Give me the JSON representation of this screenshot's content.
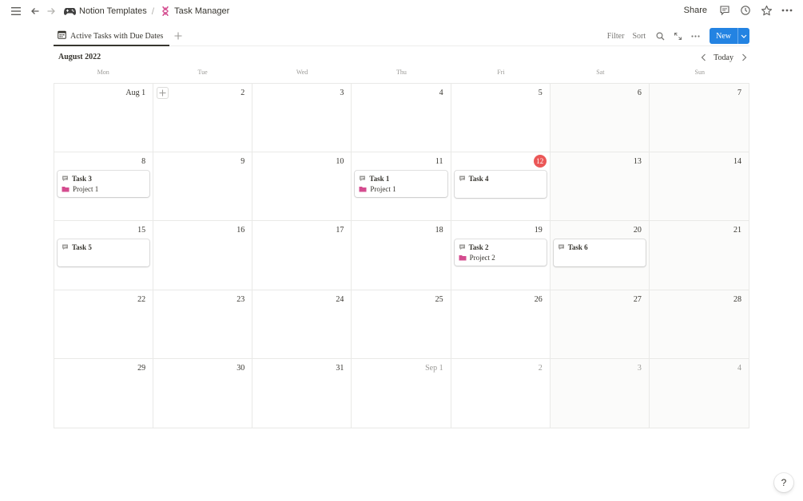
{
  "breadcrumb": {
    "workspace": "Notion Templates",
    "page": "Task Manager",
    "separator": "/"
  },
  "topbar": {
    "share_label": "Share"
  },
  "view": {
    "tab_label": "Active Tasks with Due Dates",
    "filter_label": "Filter",
    "sort_label": "Sort",
    "new_label": "New"
  },
  "calendar": {
    "month_label": "August 2022",
    "today_label": "Today",
    "weekdays": [
      "Mon",
      "Tue",
      "Wed",
      "Thu",
      "Fri",
      "Sat",
      "Sun"
    ],
    "weeks": [
      [
        {
          "label": "Aug 1",
          "muted": false
        },
        {
          "label": "2",
          "muted": false
        },
        {
          "label": "3",
          "muted": false
        },
        {
          "label": "4",
          "muted": false
        },
        {
          "label": "5",
          "muted": false
        },
        {
          "label": "6",
          "muted": false
        },
        {
          "label": "7",
          "muted": false
        }
      ],
      [
        {
          "label": "8",
          "muted": false,
          "task": {
            "title": "Task 3",
            "project": "Project 1"
          }
        },
        {
          "label": "9",
          "muted": false
        },
        {
          "label": "10",
          "muted": false
        },
        {
          "label": "11",
          "muted": false,
          "task": {
            "title": "Task 1",
            "project": "Project 1"
          }
        },
        {
          "label": "12",
          "muted": false,
          "today": true,
          "task": {
            "title": "Task 4",
            "project": ""
          }
        },
        {
          "label": "13",
          "muted": false
        },
        {
          "label": "14",
          "muted": false
        }
      ],
      [
        {
          "label": "15",
          "muted": false,
          "task": {
            "title": "Task 5",
            "project": ""
          }
        },
        {
          "label": "16",
          "muted": false
        },
        {
          "label": "17",
          "muted": false
        },
        {
          "label": "18",
          "muted": false
        },
        {
          "label": "19",
          "muted": false,
          "task": {
            "title": "Task 2",
            "project": "Project 2"
          }
        },
        {
          "label": "20",
          "muted": false,
          "task": {
            "title": "Task 6",
            "project": ""
          }
        },
        {
          "label": "21",
          "muted": false
        }
      ],
      [
        {
          "label": "22",
          "muted": false
        },
        {
          "label": "23",
          "muted": false
        },
        {
          "label": "24",
          "muted": false
        },
        {
          "label": "25",
          "muted": false
        },
        {
          "label": "26",
          "muted": false
        },
        {
          "label": "27",
          "muted": false
        },
        {
          "label": "28",
          "muted": false
        }
      ],
      [
        {
          "label": "29",
          "muted": false
        },
        {
          "label": "30",
          "muted": false
        },
        {
          "label": "31",
          "muted": false
        },
        {
          "label": "Sep 1",
          "muted": true
        },
        {
          "label": "2",
          "muted": true
        },
        {
          "label": "3",
          "muted": true
        },
        {
          "label": "4",
          "muted": true
        }
      ]
    ]
  },
  "help": {
    "label": "?"
  },
  "colors": {
    "accent": "#2383e2",
    "today": "#eb5757",
    "folder_icon": "#d44c8f",
    "task_icon": "#9b9a97"
  }
}
